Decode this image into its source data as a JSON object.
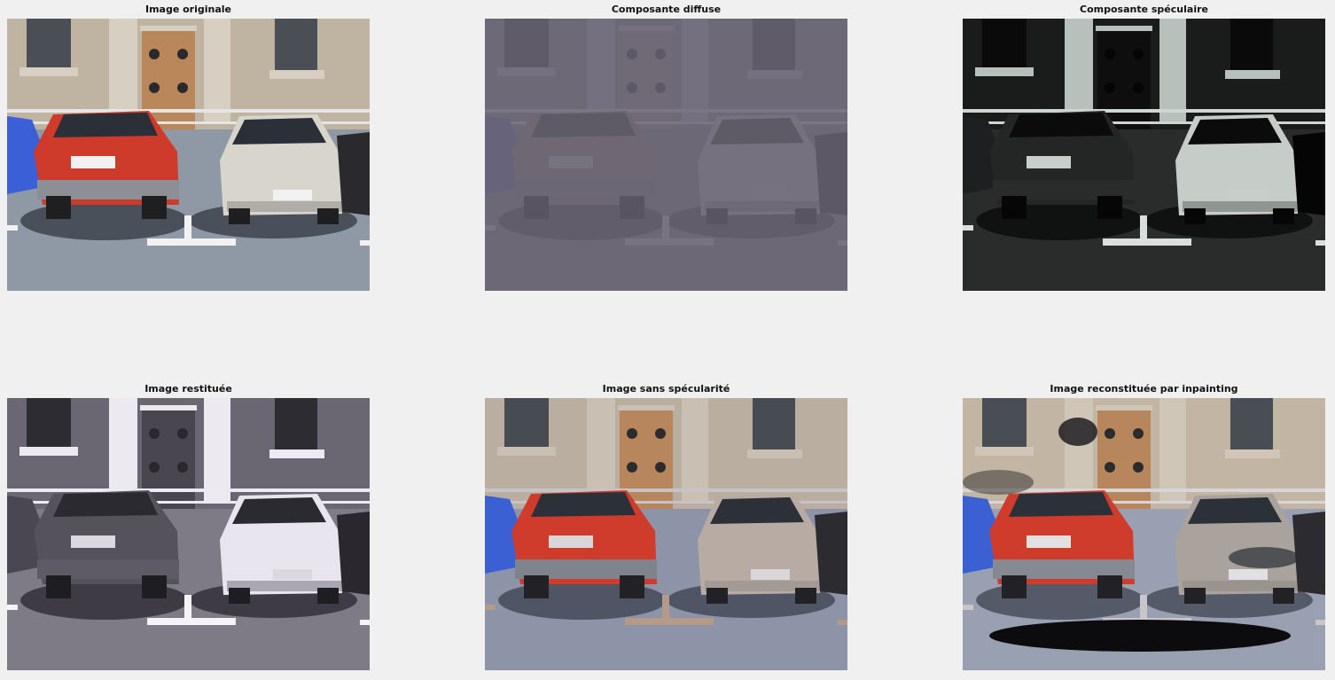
{
  "figure": {
    "panels": [
      {
        "title": "Image originale"
      },
      {
        "title": "Composante diffuse"
      },
      {
        "title": "Composante spéculaire"
      },
      {
        "title": "Image restituée"
      },
      {
        "title": "Image sans spécularité"
      },
      {
        "title": "Image reconstituée par inpainting"
      }
    ]
  }
}
